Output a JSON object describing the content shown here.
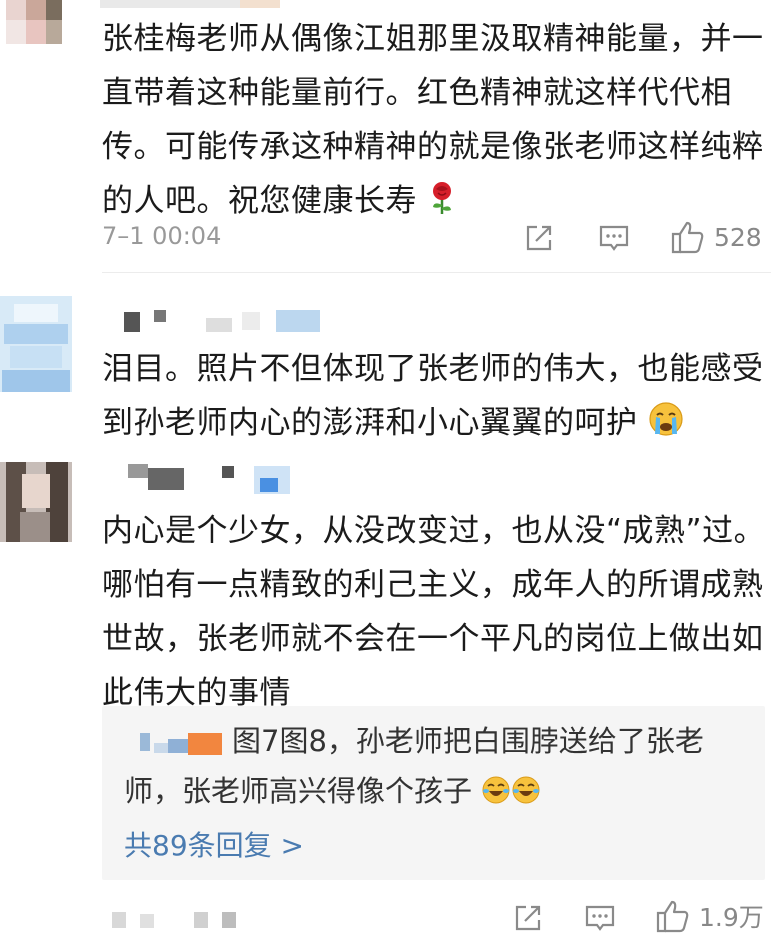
{
  "comments": [
    {
      "text": "张桂梅老师从偶像江姐那里汲取精神能量，并一直带着这种能量前行。红色精神就这样代代相传。可能传承这种精神的就是像张老师这样纯粹的人吧。祝您健康长寿",
      "emoji": "rose-emoji",
      "time": "7–1 00:04",
      "likes": "528"
    },
    {
      "text": "泪目。照片不但体现了张老师的伟大，也能感受到孙老师内心的澎湃和小心翼翼的呵护",
      "emoji": "crying-face-emoji"
    },
    {
      "text": "内心是个少女，从没改变过，也从没“成熟”过。哪怕有一点精致的利己主义，成年人的所谓成熟世故，张老师就不会在一个平凡的岗位上做出如此伟大的事情",
      "likes": "1.9万",
      "reply": {
        "text": "图7图8，孙老师把白围脖送给了张老师，张老师高兴得像个孩子",
        "emoji": "laughing-face-emoji",
        "link": "共89条回复 >"
      }
    }
  ],
  "icons": {
    "share": "share-icon",
    "comment": "comment-icon",
    "like": "thumbs-up-icon"
  },
  "colors": {
    "text": "#1b1b1b",
    "meta": "#999999",
    "link": "#4a7bb0",
    "reply_bg": "#f5f5f5"
  }
}
